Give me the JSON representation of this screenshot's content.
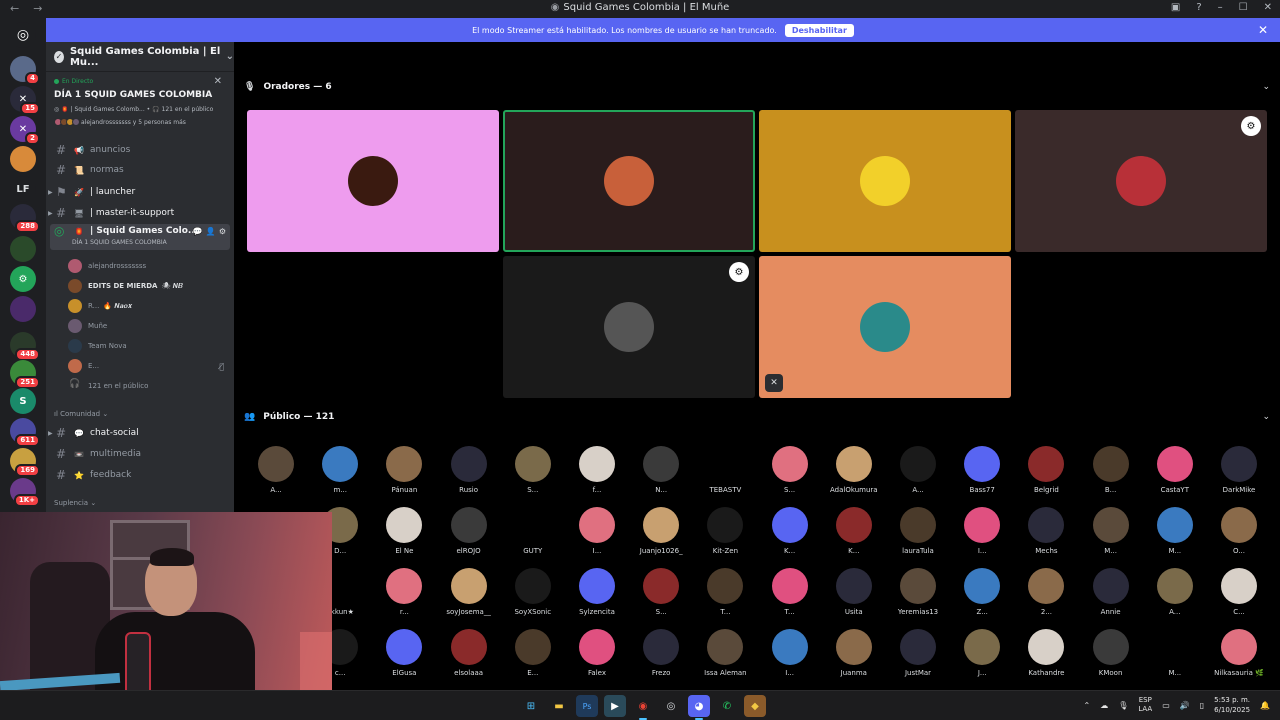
{
  "window": {
    "title": "Squid Games Colombia | El Muñe",
    "back": "←",
    "forward": "→"
  },
  "banner": {
    "text": "El modo Streamer está habilitado. Los nombres de usuario se han truncado.",
    "button": "Deshabilitar",
    "close": "✕"
  },
  "server": {
    "name": "Squid Games Colombia | El Mu...",
    "live": {
      "tag": "En Directo",
      "title": "DÍA 1 SQUID GAMES COLOMBIA",
      "meta_channel": "| Squid Games Colomb...",
      "meta_count": "121 en el público",
      "people": "alejandrosssssss y 5 personas más"
    }
  },
  "channels": {
    "anuncios": "anuncios",
    "normas": "normas",
    "launcher": "| launcher",
    "master": "| master-it-support",
    "stage": "| Squid Games Colo...",
    "stage_sub": "DÍA 1 SQUID GAMES COLOMBIA",
    "chat_social": "chat-social",
    "multimedia": "multimedia",
    "feedback": "feedback"
  },
  "categories": {
    "comunidad": "Comunidad",
    "suplencia": "Suplencia"
  },
  "voice_members": [
    {
      "name": "alejandrosssssss",
      "color": "#b05a70"
    },
    {
      "name": "EDITS DE MIERDA",
      "color": "#7a4a2a",
      "tag": "🕷 𝑵𝑩"
    },
    {
      "name": "R...",
      "color": "#c8902a",
      "tag": "🔥 𝑵𝒂𝒐𝒙"
    },
    {
      "name": "Muñe",
      "color": "#6a5a70"
    },
    {
      "name": "Team Nova",
      "color": "#2a3a4a"
    },
    {
      "name": "E...",
      "color": "#c06a4a"
    },
    {
      "name": "121 en el público",
      "color": "#000000"
    }
  ],
  "rail": {
    "home_icon": "discord-logo",
    "badges": [
      "4",
      "15",
      "2",
      "288",
      "448",
      "251",
      "611",
      "169",
      "1K+"
    ],
    "lf_label": "LF",
    "s_label": "S"
  },
  "stage": {
    "speakers_header": "Oradores — 6",
    "audience_header": "Público — 121",
    "speakers": [
      {
        "bg": "#ee9cee",
        "av": "#3a1a10",
        "speaking": false
      },
      {
        "bg": "#2a1c1c",
        "av": "#c8603a",
        "speaking": true
      },
      {
        "bg": "#c8901e",
        "av": "#f2d02a",
        "speaking": false
      },
      {
        "bg": "#3a2a2a",
        "av": "#b83038",
        "speaking": false,
        "badge": true
      },
      {
        "bg": "#1a1a1a",
        "av": "#555555",
        "speaking": false,
        "badge": true
      },
      {
        "bg": "#e58c60",
        "av": "#2a8a8a",
        "speaking": false,
        "muted": true
      }
    ]
  },
  "audience": [
    [
      "A...",
      "m...",
      "Pánuan",
      "Rusio",
      "S...",
      "f...",
      "N...",
      "TEBASTV",
      "S...",
      "AdalOkumura",
      "A...",
      "Bass77",
      "Belgrid",
      "B...",
      "CastaYT",
      "DarkMike"
    ],
    [
      "D...",
      "El Ñe",
      "elROJO",
      "GUTY",
      "I...",
      "Juanjo1026_",
      "Kit-Zen",
      "K...",
      "K...",
      "lauraTula",
      "I...",
      "Mechs",
      "M...",
      "M...",
      "O..."
    ],
    [
      "akkun★",
      "r...",
      "soyJosema__",
      "SoyXSonic",
      "Sylzencita",
      "S...",
      "T...",
      "T...",
      "Usita",
      "Yeremias13",
      "Z...",
      "2...",
      "Annie",
      "A...",
      "C..."
    ],
    [
      "c...",
      "ElGusa",
      "elsolaaa",
      "E...",
      "Falex",
      "Frezo",
      "Issa Aleman",
      "I...",
      "Juanma",
      "JustMar",
      "J...",
      "Kathandre",
      "KMoon",
      "M...",
      "Nilkasauria 🌿"
    ]
  ],
  "audience_colors": [
    "#5a4a3a",
    "#3a7ac0",
    "#8a6a4a",
    "#2a2a3a",
    "#7a6a4a",
    "#d8d0c8",
    "#3a3a3a",
    "#000000",
    "#e07080",
    "#c8a070",
    "#1a1a1a",
    "#5865f2",
    "#8a2a2a",
    "#4a3a2a",
    "#e05080",
    "#2a2a3a"
  ],
  "taskbar": {
    "lang": "ESP",
    "lang2": "LAA",
    "time": "5:53 p. m.",
    "date": "6/10/2025"
  },
  "colors": {
    "accent": "#5865f2",
    "speaking": "#23a55a",
    "badge": "#f23f43"
  }
}
